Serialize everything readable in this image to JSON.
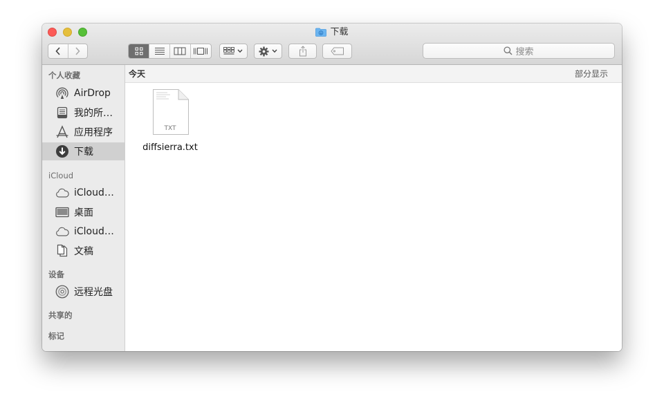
{
  "window": {
    "title": "下载"
  },
  "search": {
    "placeholder": "搜索"
  },
  "sidebar": {
    "sections": [
      {
        "header": "个人收藏",
        "items": [
          {
            "label": "AirDrop",
            "icon": "airdrop-icon"
          },
          {
            "label": "我的所…",
            "icon": "all-files-icon"
          },
          {
            "label": "应用程序",
            "icon": "applications-icon"
          },
          {
            "label": "下载",
            "icon": "downloads-icon",
            "selected": true
          }
        ]
      },
      {
        "header": "iCloud",
        "items": [
          {
            "label": "iCloud…",
            "icon": "cloud-icon"
          },
          {
            "label": "桌面",
            "icon": "desktop-icon"
          },
          {
            "label": "iCloud…",
            "icon": "cloud-icon"
          },
          {
            "label": "文稿",
            "icon": "documents-icon"
          }
        ]
      },
      {
        "header": "设备",
        "items": [
          {
            "label": "远程光盘",
            "icon": "remote-disc-icon"
          }
        ]
      },
      {
        "header": "共享的",
        "items": []
      },
      {
        "header": "标记",
        "items": []
      }
    ]
  },
  "content": {
    "group": "今天",
    "show_partial": "部分显示",
    "files": [
      {
        "name": "diffsierra.txt",
        "type_label": "TXT",
        "icon": "text-file-icon"
      }
    ]
  },
  "colors": {
    "close": "#fc5b57",
    "minimize": "#e5bf3c",
    "maximize": "#57c038",
    "sidebar_selected": "#d0d0d0",
    "toolbar_active": "#6e6e6e"
  }
}
